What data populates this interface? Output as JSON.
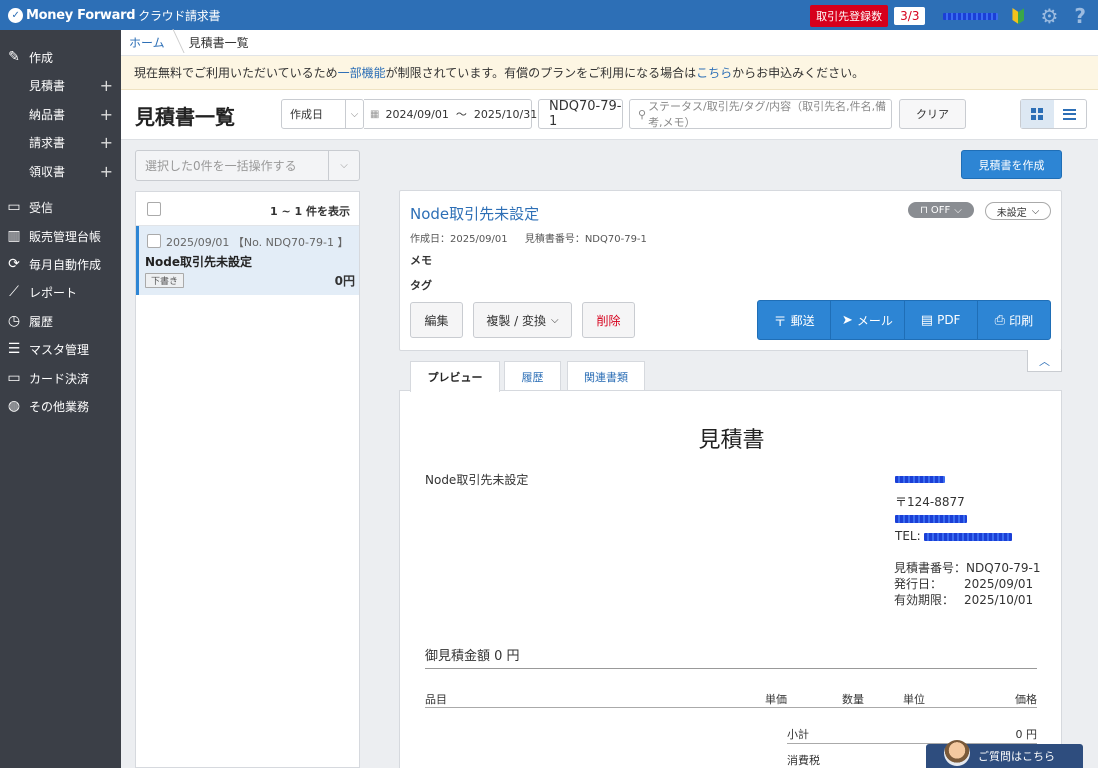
{
  "topbar": {
    "logo": "Money Forward",
    "product": "クラウド請求書",
    "registration_label": "取引先登録数",
    "registration_count": "3/3",
    "help_icon": "?"
  },
  "sidebar": {
    "items": [
      {
        "label": "作成",
        "icon": "pencil-icon"
      },
      {
        "label": "見積書",
        "sub": true
      },
      {
        "label": "納品書",
        "sub": true
      },
      {
        "label": "請求書",
        "sub": true
      },
      {
        "label": "領収書",
        "sub": true
      },
      {
        "label": "受信",
        "icon": "inbox-icon"
      },
      {
        "label": "販売管理台帳",
        "icon": "ledger-icon"
      },
      {
        "label": "毎月自動作成",
        "icon": "refresh-icon"
      },
      {
        "label": "レポート",
        "icon": "chart-icon"
      },
      {
        "label": "履歴",
        "icon": "history-icon"
      },
      {
        "label": "マスタ管理",
        "icon": "list-icon"
      },
      {
        "label": "カード決済",
        "icon": "card-icon"
      },
      {
        "label": "その他業務",
        "icon": "other-icon"
      }
    ],
    "plus": "+"
  },
  "breadcrumb": {
    "home": "ホーム",
    "current": "見積書一覧"
  },
  "notice": {
    "before": "現在無料でご利用いただいているため",
    "link1": "一部機能",
    "middle": "が制限されています。有償のプランをご利用になる場合は",
    "link2": "こちら",
    "after": "からお申込みください。"
  },
  "filter": {
    "title": "見積書一覧",
    "date_field": "作成日",
    "date_from": "2024/09/01",
    "date_sep": "〜",
    "date_to": "2025/10/31",
    "doc_number": "NDQ70-79-1",
    "search_placeholder": "ステータス/取引先/タグ/内容（取引先名,件名,備考,メモ）",
    "clear": "クリア"
  },
  "bulk": {
    "placeholder": "選択した0件を一括操作する",
    "create": "見積書を作成"
  },
  "list": {
    "count": "1 ~ 1 件を表示",
    "rows": [
      {
        "date": "2025/09/01",
        "number": "【No. NDQ70-79-1 】",
        "client": "Node取引先未設定",
        "status": "下書き",
        "amount": "0円"
      }
    ]
  },
  "detail": {
    "title": "Node取引先未設定",
    "created": "作成日：2025/09/01",
    "doc_no": "見積書番号：NDQ70-79-1",
    "memo": "メモ",
    "tag": "タグ",
    "lock": "OFF",
    "status": "未設定",
    "edit": "編集",
    "copy": "複製 / 変換",
    "delete": "削除",
    "mail_post": "郵送",
    "email": "メール",
    "pdf": "PDF",
    "print": "印刷"
  },
  "tabs": [
    {
      "label": "プレビュー"
    },
    {
      "label": "履歴"
    },
    {
      "label": "関連書類"
    }
  ],
  "preview": {
    "title": "見積書",
    "client": "Node取引先未設定",
    "postal": "〒124-8877",
    "tel": "TEL:",
    "doc_no_label": "見積書番号：",
    "doc_no": "NDQ70-79-1",
    "issue_label": "発行日：",
    "issue_date": "2025/09/01",
    "expiry_label": "有効期限：",
    "expiry_date": "2025/10/01",
    "total": "御見積金額 0 円",
    "columns": {
      "item": "品目",
      "unit_price": "単価",
      "qty": "数量",
      "unit": "単位",
      "price": "価格"
    },
    "subtotal_label": "小計",
    "subtotal": "0 円",
    "tax_label": "消費税"
  },
  "chat": {
    "label": "ご質問はこちら"
  }
}
